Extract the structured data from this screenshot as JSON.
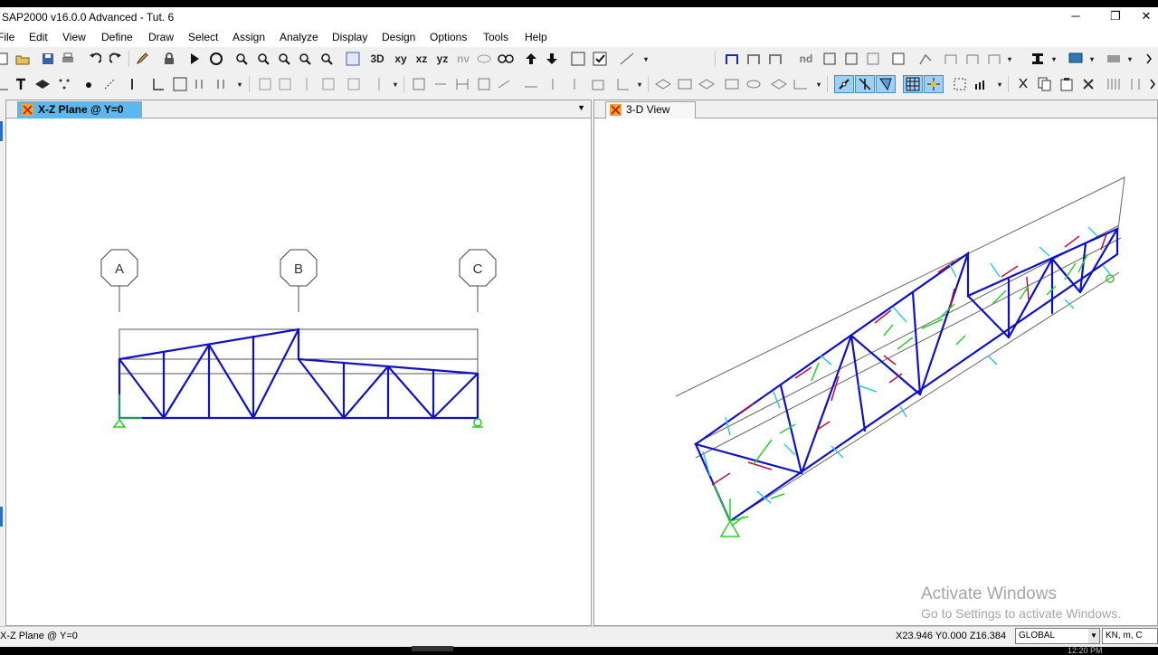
{
  "app": {
    "title": "SAP2000 v16.0.0 Advanced  -  Tut. 6",
    "window_buttons": {
      "minimize": "─",
      "restore": "❐",
      "close": "✕"
    }
  },
  "menu": [
    "File",
    "Edit",
    "View",
    "Define",
    "Draw",
    "Select",
    "Assign",
    "Analyze",
    "Display",
    "Design",
    "Options",
    "Tools",
    "Help"
  ],
  "toolbar1_text": {
    "set3d": "3D",
    "xy": "xy",
    "xz": "xz",
    "yz": "yz",
    "nv": "nv",
    "nd": "nd"
  },
  "left_view": {
    "tab_label": "X-Z Plane @ Y=0",
    "grid_labels": [
      "A",
      "B",
      "C"
    ]
  },
  "right_view": {
    "tab_label": "3-D View"
  },
  "status": {
    "left_text": "X-Z Plane @ Y=0",
    "coords": "X23.946  Y0.000  Z16.384",
    "coord_system": "GLOBAL",
    "units": "KN, m, C"
  },
  "watermark": {
    "line1": "Activate Windows",
    "line2": "Go to Settings to activate Windows."
  },
  "clock": "12:20 PM",
  "colors": {
    "frame": "#1010c8",
    "grid": "#505050",
    "active_tab": "#5bb8f0",
    "local_axis_1": "#c0103a",
    "local_axis_2": "#28d028",
    "local_axis_3": "#30c8e0"
  }
}
